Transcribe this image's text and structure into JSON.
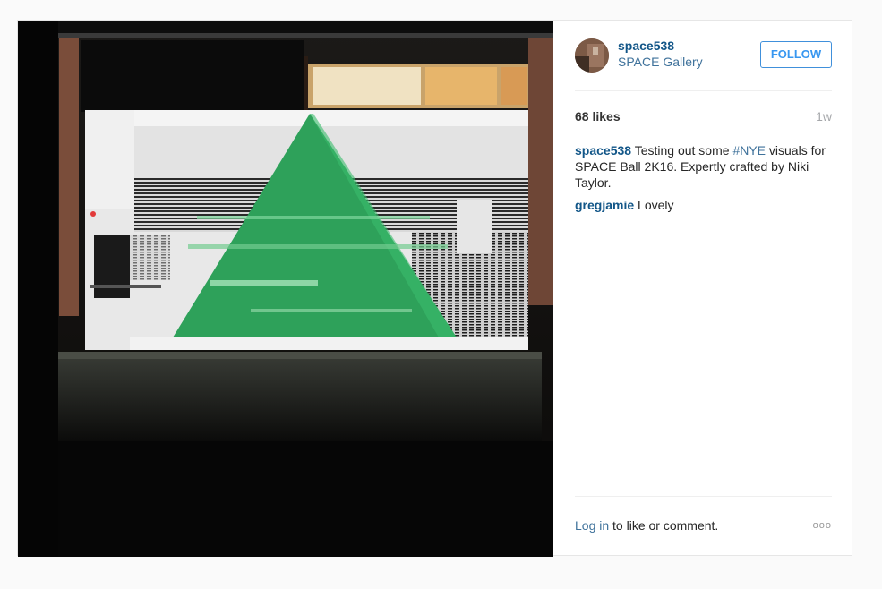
{
  "post": {
    "username": "space538",
    "location": "SPACE Gallery",
    "follow_label": "FOLLOW",
    "likes": "68 likes",
    "time": "1w",
    "caption": {
      "user": "space538",
      "text_before": "Testing out some ",
      "hashtag": "#NYE",
      "text_after": " visuals for SPACE Ball 2K16. Expertly crafted by Niki Taylor."
    },
    "comments": [
      {
        "user": "gregjamie",
        "text": "Lovely"
      }
    ],
    "login_link": "Log in",
    "login_rest": " to like or comment.",
    "more_icon": "ooo"
  },
  "colors": {
    "username": "#125688",
    "link": "#3f729b",
    "follow_border": "#4090db",
    "pyramid": "#2ea15a"
  },
  "icons": {
    "more": "more-options-icon"
  }
}
